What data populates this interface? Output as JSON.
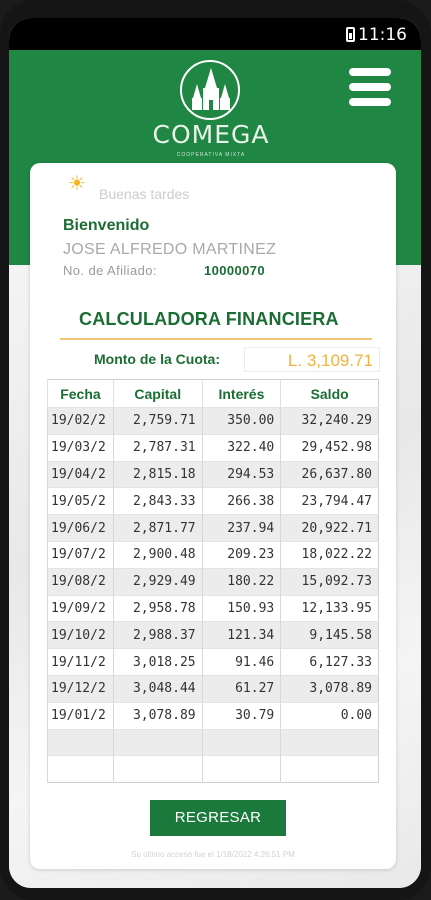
{
  "status_bar": {
    "time": "11:16"
  },
  "header": {
    "brand": "COMEGA",
    "brand_sub": "COOPERATIVA MIXTA",
    "menu_icon": "hamburger-icon",
    "accent": "#1f8743"
  },
  "greeting": {
    "icon": "sun-icon",
    "text": "Buenas tardes"
  },
  "user": {
    "welcome": "Bienvenido",
    "name": "JOSE ALFREDO MARTINEZ",
    "affiliate_label": "No. de Afiliado:",
    "affiliate_number": "10000070"
  },
  "calculator": {
    "title": "CALCULADORA FINANCIERA",
    "cuota_label": "Monto de la Cuota:",
    "cuota_value": "L. 3,109.71",
    "columns": [
      "Fecha",
      "Capital",
      "Interés",
      "Saldo"
    ],
    "rows": [
      [
        "19/02/2",
        "2,759.71",
        "350.00",
        "32,240.29"
      ],
      [
        "19/03/2",
        "2,787.31",
        "322.40",
        "29,452.98"
      ],
      [
        "19/04/2",
        "2,815.18",
        "294.53",
        "26,637.80"
      ],
      [
        "19/05/2",
        "2,843.33",
        "266.38",
        "23,794.47"
      ],
      [
        "19/06/2",
        "2,871.77",
        "237.94",
        "20,922.71"
      ],
      [
        "19/07/2",
        "2,900.48",
        "209.23",
        "18,022.22"
      ],
      [
        "19/08/2",
        "2,929.49",
        "180.22",
        "15,092.73"
      ],
      [
        "19/09/2",
        "2,958.78",
        "150.93",
        "12,133.95"
      ],
      [
        "19/10/2",
        "2,988.37",
        "121.34",
        "9,145.58"
      ],
      [
        "19/11/2",
        "3,018.25",
        "91.46",
        "6,127.33"
      ],
      [
        "19/12/2",
        "3,048.44",
        "61.27",
        "3,078.89"
      ],
      [
        "19/01/2",
        "3,078.89",
        "30.79",
        "0.00"
      ],
      [
        "",
        "",
        "",
        ""
      ],
      [
        "",
        "",
        "",
        ""
      ]
    ]
  },
  "actions": {
    "back_label": "REGRESAR"
  },
  "footer": {
    "last_access": "Su último acceso fue el 1/18/2022 4:26:51 PM"
  }
}
